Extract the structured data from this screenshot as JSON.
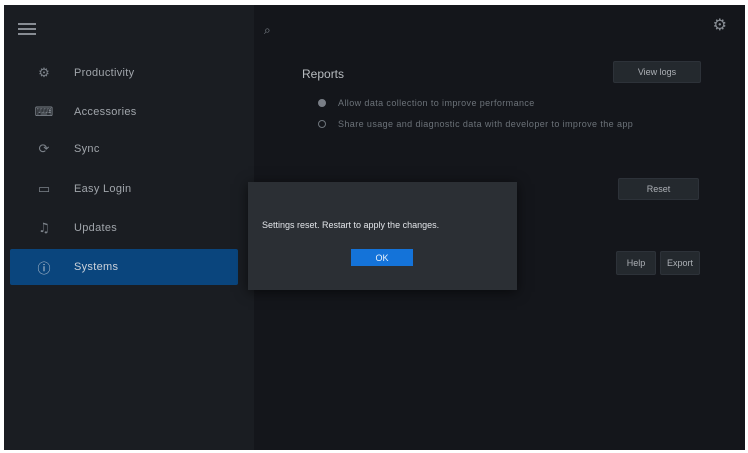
{
  "sidebar": {
    "menu_icon": "hamburger-icon",
    "items": [
      {
        "label": "Productivity",
        "icon": "productivity-icon",
        "active": false
      },
      {
        "label": "Accessories",
        "icon": "keyboard-icon",
        "active": false
      },
      {
        "label": "Sync",
        "icon": "sync-icon",
        "active": false
      },
      {
        "label": "Easy Login",
        "icon": "login-icon",
        "active": false
      },
      {
        "label": "Updates",
        "icon": "bell-icon",
        "active": false
      },
      {
        "label": "Systems",
        "icon": "info-icon",
        "active": true
      }
    ]
  },
  "header": {
    "search_icon": "search-icon",
    "settings_icon": "gear-icon"
  },
  "main": {
    "section_title": "Reports",
    "options": [
      "Allow data collection to improve performance",
      "Share usage and diagnostic data with developer to improve the app"
    ],
    "buttons": {
      "view_logs": "View logs",
      "reset": "Reset",
      "help": "Help",
      "export": "Export"
    }
  },
  "dialog": {
    "message": "Settings reset. Restart to apply the changes.",
    "ok_label": "OK"
  },
  "colors": {
    "accent": "#1473d9",
    "sidebar_bg": "#1e2227",
    "main_bg": "#171a1f",
    "active_item": "#0c4f8f"
  }
}
